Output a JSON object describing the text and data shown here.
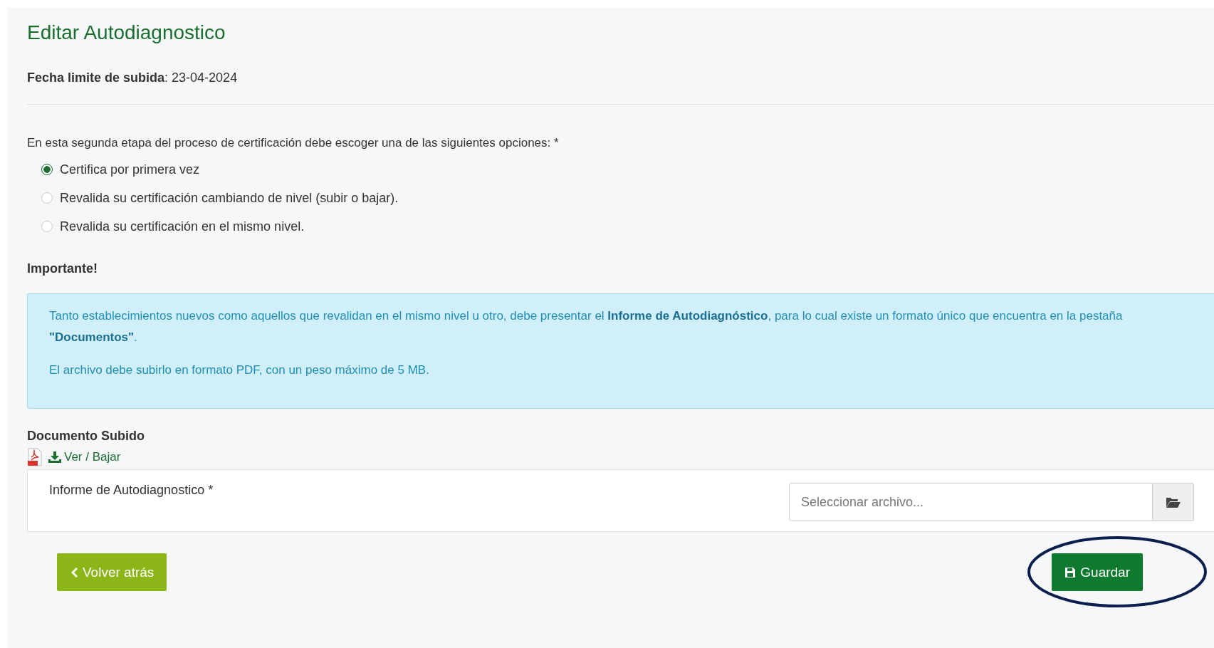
{
  "title": "Editar Autodiagnostico",
  "deadline": {
    "label": "Fecha limite de subida",
    "value": ": 23-04-2024"
  },
  "prompt": "En esta segunda etapa del proceso de certificación debe escoger una de las siguientes opciones: *",
  "options": [
    {
      "label": "Certifica por primera vez",
      "selected": true
    },
    {
      "label": "Revalida su certificación cambiando de nivel (subir o bajar).",
      "selected": false
    },
    {
      "label": "Revalida su certificación en el mismo nivel.",
      "selected": false
    }
  ],
  "important_heading": "Importante!",
  "info": [
    "Tanto establecimientos nuevos como aquellos que revalidan en el mismo nivel u otro, debe presentar el **Informe de Autodiagnóstico**, para lo cual existe un formato único que encuentra en la pestaña **\"Documentos\"**.",
    "El archivo debe subirlo en formato PDF, con un peso máximo de 5 MB."
  ],
  "uploaded": {
    "heading": "Documento Subido",
    "link": "Ver / Bajar"
  },
  "file_field": {
    "label": "Informe de Autodiagnostico *",
    "placeholder": "Seleccionar archivo..."
  },
  "back_button": "Volver atrás",
  "save_button": {
    "label": "Guardar",
    "circled": true
  }
}
